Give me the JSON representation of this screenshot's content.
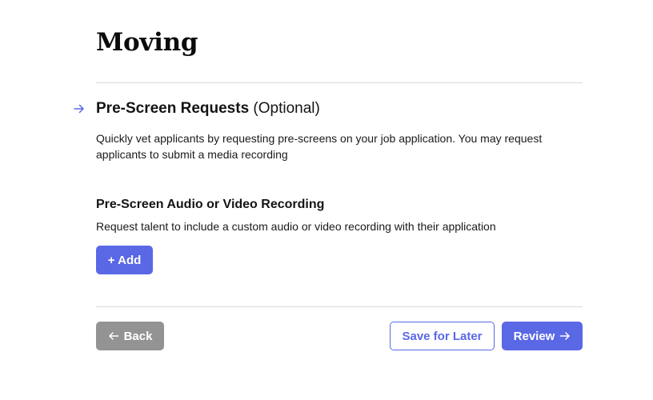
{
  "page": {
    "title": "Moving"
  },
  "section": {
    "heading_strong": "Pre-Screen Requests",
    "heading_optional": " (Optional)",
    "description": "Quickly vet applicants by requesting pre-screens on your job application. You may request applicants to submit a media recording",
    "icon": "arrow-right-icon"
  },
  "recording": {
    "heading": "Pre-Screen Audio or Video Recording",
    "description": "Request talent to include a custom audio or video recording with their application",
    "add_label": "+ Add"
  },
  "footer": {
    "back_label": "Back",
    "save_label": "Save for Later",
    "review_label": "Review"
  },
  "colors": {
    "accent": "#5a68e6",
    "back_button": "#939393",
    "divider": "#d9d9d9"
  }
}
